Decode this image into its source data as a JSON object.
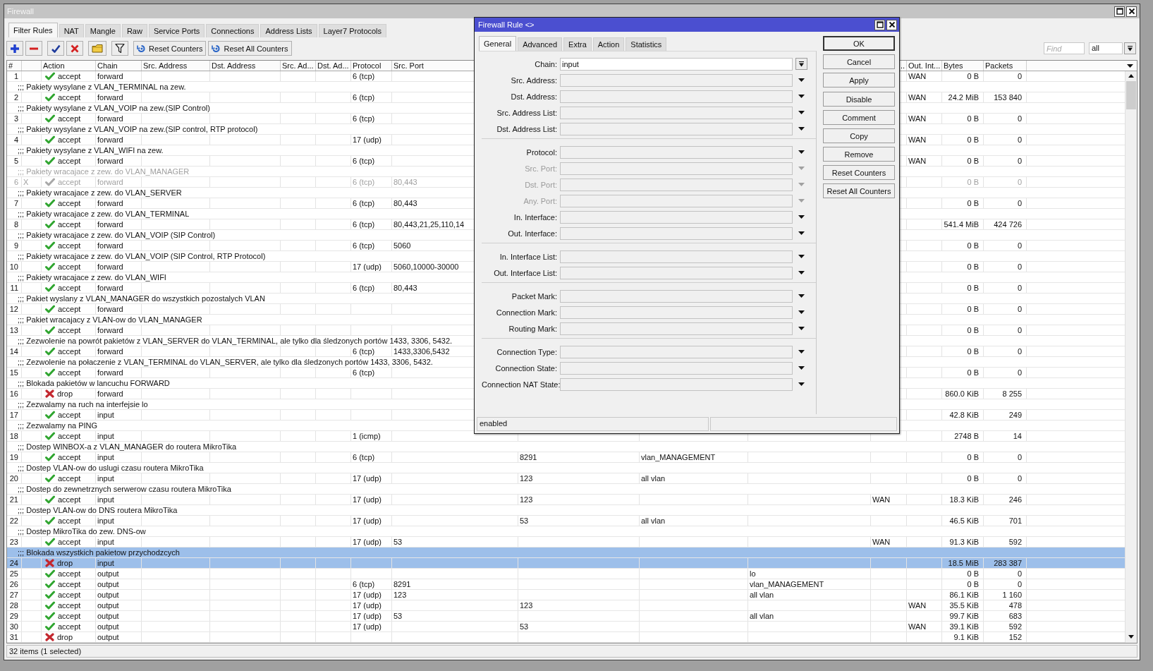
{
  "window": {
    "title": "Firewall"
  },
  "tabs": [
    {
      "label": "Filter Rules",
      "selected": true
    },
    {
      "label": "NAT",
      "selected": false
    },
    {
      "label": "Mangle",
      "selected": false
    },
    {
      "label": "Raw",
      "selected": false
    },
    {
      "label": "Service Ports",
      "selected": false
    },
    {
      "label": "Connections",
      "selected": false
    },
    {
      "label": "Address Lists",
      "selected": false
    },
    {
      "label": "Layer7 Protocols",
      "selected": false
    }
  ],
  "toolbar": {
    "groups": [
      {
        "buttons": [
          {
            "kind": "add"
          },
          {
            "kind": "remove"
          }
        ]
      },
      {
        "buttons": [
          {
            "kind": "enable"
          },
          {
            "kind": "disable"
          }
        ]
      },
      {
        "buttons": [
          {
            "kind": "comment"
          }
        ]
      },
      {
        "buttons": [
          {
            "kind": "filter"
          }
        ]
      },
      {
        "buttons": [
          {
            "kind": "reset",
            "label": "Reset Counters"
          },
          {
            "kind": "reset",
            "label": "Reset All Counters"
          }
        ]
      }
    ],
    "find": {
      "placeholder": "Find"
    },
    "filter_select": {
      "value": "all"
    }
  },
  "table": {
    "columns": [
      "#",
      "Action",
      "Chain",
      "Src. Address",
      "Dst. Address",
      "Src. Ad...",
      "Dst. Ad...",
      "Protocol",
      "Src. Port",
      "..",
      "Out. Int...",
      "Bytes",
      "Packets"
    ],
    "rules": [
      {
        "num": "1",
        "kind": "accept",
        "action": "accept",
        "chain": "forward",
        "protocol": "6 (tcp)",
        "out_interface": "WAN",
        "bytes": "0 B",
        "packets": "0",
        "disabled": false,
        "selected": false
      },
      {
        "comment": ";;; Pakiety wysylane z VLAN_TERMINAL na zew.",
        "num": "2",
        "kind": "accept",
        "action": "accept",
        "chain": "forward",
        "protocol": "6 (tcp)",
        "out_interface": "WAN",
        "bytes": "24.2 MiB",
        "packets": "153 840",
        "disabled": false,
        "selected": false
      },
      {
        "comment": ";;; Pakiety wysylane z VLAN_VOIP na zew.(SIP Control)",
        "num": "3",
        "kind": "accept",
        "action": "accept",
        "chain": "forward",
        "protocol": "6 (tcp)",
        "out_interface": "WAN",
        "bytes": "0 B",
        "packets": "0",
        "disabled": false,
        "selected": false
      },
      {
        "comment": ";;; Pakiety wysylane z VLAN_VOIP na zew.(SIP control, RTP protocol)",
        "num": "4",
        "kind": "accept",
        "action": "accept",
        "chain": "forward",
        "protocol": "17 (udp)",
        "out_interface": "WAN",
        "bytes": "0 B",
        "packets": "0",
        "disabled": false,
        "selected": false
      },
      {
        "comment": ";;; Pakiety wysylane z VLAN_WIFI na zew.",
        "num": "5",
        "kind": "accept",
        "action": "accept",
        "chain": "forward",
        "protocol": "6 (tcp)",
        "out_interface": "WAN",
        "bytes": "0 B",
        "packets": "0",
        "disabled": false,
        "selected": false
      },
      {
        "comment": ";;; Pakiety wracajace z zew. do VLAN_MANAGER",
        "num": "6",
        "flag": "X",
        "kind": "accept",
        "action": "accept",
        "chain": "forward",
        "protocol": "6 (tcp)",
        "src_port": "80,443",
        "bytes": "0 B",
        "packets": "0",
        "disabled": true,
        "selected": false
      },
      {
        "comment": ";;; Pakiety wracajace z zew. do VLAN_SERVER",
        "num": "7",
        "kind": "accept",
        "action": "accept",
        "chain": "forward",
        "protocol": "6 (tcp)",
        "src_port": "80,443",
        "bytes": "0 B",
        "packets": "0",
        "disabled": false,
        "selected": false
      },
      {
        "comment": ";;; Pakiety wracajace z zew. do VLAN_TERMINAL",
        "num": "8",
        "kind": "accept",
        "action": "accept",
        "chain": "forward",
        "protocol": "6 (tcp)",
        "src_port": "80,443,21,25,110,14",
        "bytes": "541.4 MiB",
        "packets": "424 726",
        "disabled": false,
        "selected": false
      },
      {
        "comment": ";;; Pakiety wracajace z zew. do VLAN_VOIP (SIP Control)",
        "num": "9",
        "kind": "accept",
        "action": "accept",
        "chain": "forward",
        "protocol": "6 (tcp)",
        "src_port": "5060",
        "bytes": "0 B",
        "packets": "0",
        "disabled": false,
        "selected": false
      },
      {
        "comment": ";;; Pakiety wracajace z zew. do VLAN_VOIP (SIP Control, RTP Protocol)",
        "num": "10",
        "kind": "accept",
        "action": "accept",
        "chain": "forward",
        "protocol": "17 (udp)",
        "src_port": "5060,10000-30000",
        "bytes": "0 B",
        "packets": "0",
        "disabled": false,
        "selected": false
      },
      {
        "comment": ";;; Pakiety wracajace z zew. do VLAN_WIFI",
        "num": "11",
        "kind": "accept",
        "action": "accept",
        "chain": "forward",
        "protocol": "6 (tcp)",
        "src_port": "80,443",
        "bytes": "0 B",
        "packets": "0",
        "disabled": false,
        "selected": false
      },
      {
        "comment": ";;; Pakiet wyslany z VLAN_MANAGER do wszystkich pozostalych VLAN",
        "num": "12",
        "kind": "accept",
        "action": "accept",
        "chain": "forward",
        "bytes": "0 B",
        "packets": "0",
        "disabled": false,
        "selected": false
      },
      {
        "comment": ";;; Pakiet wracajacy z VLAN-ow do VLAN_MANAGER",
        "num": "13",
        "kind": "accept",
        "action": "accept",
        "chain": "forward",
        "bytes": "0 B",
        "packets": "0",
        "disabled": false,
        "selected": false
      },
      {
        "comment": ";;; Zezwolenie na powrót pakietów z VLAN_SERVER do VLAN_TERMINAL, ale tylko dla śledzonych portów 1433, 3306, 5432.",
        "num": "14",
        "kind": "accept",
        "action": "accept",
        "chain": "forward",
        "protocol": "6 (tcp)",
        "src_port": "1433,3306,5432",
        "bytes": "0 B",
        "packets": "0",
        "disabled": false,
        "selected": false
      },
      {
        "comment": ";;; Zezwolenie na połaczenie z VLAN_TERMINAL do VLAN_SERVER, ale tylko dla śledzonych portów 1433, 3306, 5432.",
        "num": "15",
        "kind": "accept",
        "action": "accept",
        "chain": "forward",
        "protocol": "6 (tcp)",
        "bytes": "0 B",
        "packets": "0",
        "disabled": false,
        "selected": false
      },
      {
        "comment": ";;; Blokada pakietów w lancuchu FORWARD",
        "num": "16",
        "kind": "drop",
        "action": "drop",
        "chain": "forward",
        "bytes": "860.0 KiB",
        "packets": "8 255",
        "disabled": false,
        "selected": false
      },
      {
        "comment": ";;; Zezwalamy na ruch na interfejsie lo",
        "num": "17",
        "kind": "accept",
        "action": "accept",
        "chain": "input",
        "bytes": "42.8 KiB",
        "packets": "249",
        "disabled": false,
        "selected": false
      },
      {
        "comment": ";;; Zezwalamy na PING",
        "num": "18",
        "kind": "accept",
        "action": "accept",
        "chain": "input",
        "protocol": "1 (icmp)",
        "bytes": "2748 B",
        "packets": "14",
        "disabled": false,
        "selected": false
      },
      {
        "comment": ";;; Dostep WINBOX-a z VLAN_MANAGER do routera MikroTika",
        "num": "19",
        "kind": "accept",
        "action": "accept",
        "chain": "input",
        "protocol": "6 (tcp)",
        "column_11": "8291",
        "column_12": "vlan_MANAGEMENT",
        "bytes": "0 B",
        "packets": "0",
        "disabled": false,
        "selected": false
      },
      {
        "comment": ";;; Dostep VLAN-ow do uslugi czasu routera MikroTika",
        "num": "20",
        "kind": "accept",
        "action": "accept",
        "chain": "input",
        "protocol": "17 (udp)",
        "column_11": "123",
        "column_12": "all vlan",
        "bytes": "0 B",
        "packets": "0",
        "disabled": false,
        "selected": false
      },
      {
        "comment": ";;; Dostep do zewnetrznych serwerow czasu routera MikroTika",
        "num": "21",
        "kind": "accept",
        "action": "accept",
        "chain": "input",
        "protocol": "17 (udp)",
        "column_11": "123",
        "column_14": "WAN",
        "bytes": "18.3 KiB",
        "packets": "246",
        "disabled": false,
        "selected": false
      },
      {
        "comment": ";;; Dostep VLAN-ow do DNS routera MikroTika",
        "num": "22",
        "kind": "accept",
        "action": "accept",
        "chain": "input",
        "protocol": "17 (udp)",
        "column_11": "53",
        "column_12": "all vlan",
        "bytes": "46.5 KiB",
        "packets": "701",
        "disabled": false,
        "selected": false
      },
      {
        "comment": ";;; Dostep MikroTika do zew. DNS-ow",
        "num": "23",
        "kind": "accept",
        "action": "accept",
        "chain": "input",
        "protocol": "17 (udp)",
        "src_port": "53",
        "column_14": "WAN",
        "bytes": "91.3 KiB",
        "packets": "592",
        "disabled": false,
        "selected": false
      },
      {
        "comment": ";;; Blokada wszystkich pakietow przychodzcych",
        "num": "24",
        "kind": "drop",
        "action": "drop",
        "chain": "input",
        "bytes": "18.5 MiB",
        "packets": "283 387",
        "disabled": false,
        "selected": true
      },
      {
        "num": "25",
        "kind": "accept",
        "action": "accept",
        "chain": "output",
        "column_13": "lo",
        "bytes": "0 B",
        "packets": "0",
        "disabled": false,
        "selected": false
      },
      {
        "num": "26",
        "kind": "accept",
        "action": "accept",
        "chain": "output",
        "protocol": "6 (tcp)",
        "src_port": "8291",
        "column_13": "vlan_MANAGEMENT",
        "bytes": "0 B",
        "packets": "0",
        "disabled": false,
        "selected": false
      },
      {
        "num": "27",
        "kind": "accept",
        "action": "accept",
        "chain": "output",
        "protocol": "17 (udp)",
        "src_port": "123",
        "column_13": "all vlan",
        "bytes": "86.1 KiB",
        "packets": "1 160",
        "disabled": false,
        "selected": false
      },
      {
        "num": "28",
        "kind": "accept",
        "action": "accept",
        "chain": "output",
        "protocol": "17 (udp)",
        "column_11": "123",
        "out_interface": "WAN",
        "bytes": "35.5 KiB",
        "packets": "478",
        "disabled": false,
        "selected": false
      },
      {
        "num": "29",
        "kind": "accept",
        "action": "accept",
        "chain": "output",
        "protocol": "17 (udp)",
        "src_port": "53",
        "column_13": "all vlan",
        "bytes": "99.7 KiB",
        "packets": "683",
        "disabled": false,
        "selected": false
      },
      {
        "num": "30",
        "kind": "accept",
        "action": "accept",
        "chain": "output",
        "protocol": "17 (udp)",
        "column_11": "53",
        "out_interface": "WAN",
        "bytes": "39.1 KiB",
        "packets": "592",
        "disabled": false,
        "selected": false
      },
      {
        "num": "31",
        "kind": "drop",
        "action": "drop",
        "chain": "output",
        "bytes": "9.1 KiB",
        "packets": "152",
        "disabled": false,
        "selected": false
      }
    ]
  },
  "status_bar": "32 items (1 selected)",
  "dialog": {
    "title": "Firewall Rule <>",
    "tabs": [
      {
        "label": "General",
        "selected": true
      },
      {
        "label": "Advanced",
        "selected": false
      },
      {
        "label": "Extra",
        "selected": false
      },
      {
        "label": "Action",
        "selected": false
      },
      {
        "label": "Statistics",
        "selected": false
      }
    ],
    "field_groups": [
      {
        "fields": [
          {
            "kind": "combo",
            "label": "Chain:",
            "value": "input",
            "disabled": false
          },
          {
            "kind": "dropdown",
            "label": "Src. Address:",
            "disabled": false
          },
          {
            "kind": "dropdown",
            "label": "Dst. Address:",
            "disabled": false
          },
          {
            "kind": "dropdown",
            "label": "Src. Address List:",
            "disabled": false
          },
          {
            "kind": "dropdown",
            "label": "Dst. Address List:",
            "disabled": false
          }
        ]
      },
      {
        "fields": [
          {
            "kind": "dropdown",
            "label": "Protocol:",
            "disabled": false
          },
          {
            "kind": "dropdown",
            "label": "Src. Port:",
            "disabled": true
          },
          {
            "kind": "dropdown",
            "label": "Dst. Port:",
            "disabled": true
          },
          {
            "kind": "dropdown",
            "label": "Any. Port:",
            "disabled": true
          },
          {
            "kind": "dropdown",
            "label": "In. Interface:",
            "disabled": false
          },
          {
            "kind": "dropdown",
            "label": "Out. Interface:",
            "disabled": false
          }
        ]
      },
      {
        "fields": [
          {
            "kind": "dropdown",
            "label": "In. Interface List:",
            "disabled": false
          },
          {
            "kind": "dropdown",
            "label": "Out. Interface List:",
            "disabled": false
          }
        ]
      },
      {
        "fields": [
          {
            "kind": "dropdown",
            "label": "Packet Mark:",
            "disabled": false
          },
          {
            "kind": "dropdown",
            "label": "Connection Mark:",
            "disabled": false
          },
          {
            "kind": "dropdown",
            "label": "Routing Mark:",
            "disabled": false
          }
        ]
      },
      {
        "fields": [
          {
            "kind": "dropdown",
            "label": "Connection Type:",
            "disabled": false
          },
          {
            "kind": "dropdown",
            "label": "Connection State:",
            "disabled": false
          },
          {
            "kind": "dropdown",
            "label": "Connection NAT State:",
            "disabled": false
          }
        ]
      }
    ],
    "button_groups": [
      {
        "buttons": [
          {
            "label": "OK",
            "default": true
          },
          {
            "label": "Cancel",
            "default": false
          },
          {
            "label": "Apply",
            "default": false
          }
        ]
      },
      {
        "buttons": [
          {
            "label": "Disable",
            "default": false
          },
          {
            "label": "Comment",
            "default": false
          },
          {
            "label": "Copy",
            "default": false
          },
          {
            "label": "Remove",
            "default": false
          },
          {
            "label": "Reset Counters",
            "default": false
          },
          {
            "label": "Reset All Counters",
            "default": false
          }
        ]
      }
    ],
    "status": "enabled"
  }
}
